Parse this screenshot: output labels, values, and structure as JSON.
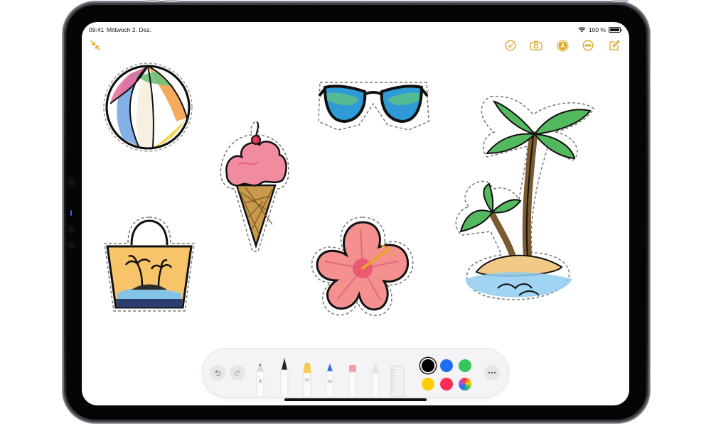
{
  "status_bar": {
    "time": "09:41",
    "date": "Mittwoch 2. Dez.",
    "battery": "100 %"
  },
  "toolbar": {
    "left_icon": "collapse-arrows-icon",
    "right_icons": [
      "checklist-icon",
      "camera-icon",
      "markup-pen-icon",
      "more-icon",
      "compose-icon"
    ],
    "accent_color": "#e0a21b"
  },
  "canvas": {
    "stickers": [
      "beach-ball",
      "ice-cream-cone",
      "sunglasses",
      "hibiscus-flower",
      "beach-bag",
      "palm-tree-island"
    ]
  },
  "tool_palette": {
    "undo_icon": "undo-icon",
    "redo_icon": "redo-icon",
    "tools": [
      {
        "name": "pencil-a",
        "label": "A"
      },
      {
        "name": "pen"
      },
      {
        "name": "marker-yellow",
        "label": "50"
      },
      {
        "name": "pen-blue",
        "label": "50"
      },
      {
        "name": "eraser"
      },
      {
        "name": "pencil-shading"
      },
      {
        "name": "ruler"
      }
    ],
    "colors": [
      "#000000",
      "#1b6ff2",
      "#34c759",
      "#ffcc00",
      "#ff2d55",
      "color-wheel"
    ],
    "selected_color": "#000000",
    "more_icon": "more-icon"
  }
}
